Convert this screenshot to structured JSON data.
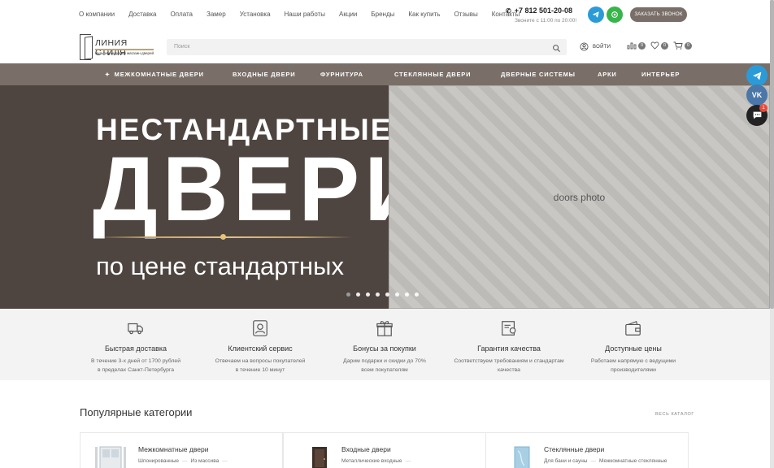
{
  "topnav": [
    "О компании",
    "Доставка",
    "Оплата",
    "Замер",
    "Установка",
    "Наши работы",
    "Акции",
    "Бренды",
    "Как купить",
    "Отзывы",
    "Контакты"
  ],
  "contact": {
    "phone": "+7 812 501-20-08",
    "hours": "Звоните с 11:00 по 20:00!",
    "callback_label": "ЗАКАЗАТЬ ЗВОНОК"
  },
  "logo": {
    "name": "ЛИНИЯ СТИЛЯ",
    "tagline": "мультибрендовый магазин дверей"
  },
  "search": {
    "placeholder": "Поиск"
  },
  "user": {
    "login_label": "ВОЙТИ",
    "compare_count": "0",
    "favorites_count": "0",
    "cart_count": "0"
  },
  "mainnav": [
    {
      "label": "МЕЖКОМНАТНЫЕ ДВЕРИ"
    },
    {
      "label": "ВХОДНЫЕ ДВЕРИ"
    },
    {
      "label": "ФУРНИТУРА"
    },
    {
      "label": "СТЕКЛЯННЫЕ ДВЕРИ"
    },
    {
      "label": "ДВЕРНЫЕ СИСТЕМЫ"
    },
    {
      "label": "АРКИ"
    },
    {
      "label": "ИНТЕРЬЕР"
    }
  ],
  "hero": {
    "line1": "НЕСТАНДАРТНЫЕ",
    "line2": "ДВЕРИ",
    "line3": "по цене стандартных",
    "slide_count": 8,
    "active_slide": 1
  },
  "chat_badge": "1",
  "features": [
    {
      "title": "Быстрая доставка",
      "line1": "В течение 3-х дней от 1700 рублей",
      "line2": "в пределах Санкт-Петербурга"
    },
    {
      "title": "Клиентский сервис",
      "line1": "Отвечаем на вопросы покупателей",
      "line2": "в течение 10 минут"
    },
    {
      "title": "Бонусы за покупки",
      "line1": "Дарим подарки и скидки до 70%",
      "line2": "всем покупателям"
    },
    {
      "title": "Гарантия качества",
      "line1": "Соответствуем требованиям и стандартам",
      "line2": "качества"
    },
    {
      "title": "Доступные цены",
      "line1": "Работаем напрямую с ведущими",
      "line2": "производителями"
    }
  ],
  "categories": {
    "title": "Популярные категории",
    "all_label": "ВЕСЬ КАТАЛОГ",
    "items": [
      {
        "name": "Межкомнатные двери",
        "sub1": "Шпонированные",
        "sub2": "Из массива"
      },
      {
        "name": "Входные двери",
        "sub1": "Металлические входные",
        "sub2": ""
      },
      {
        "name": "Стеклянные двери",
        "sub1": "Для бани и сауны",
        "sub2": "Межкомнатные стеклянные"
      }
    ]
  }
}
